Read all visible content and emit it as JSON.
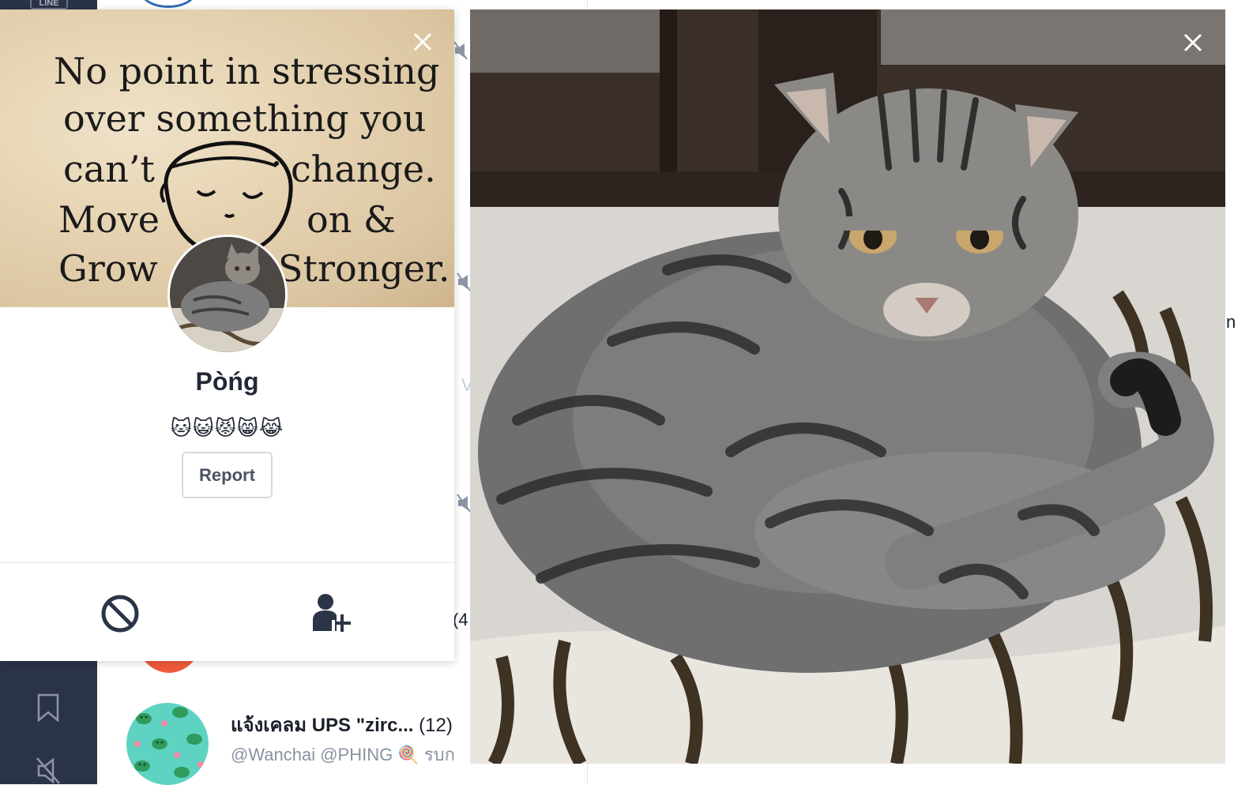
{
  "app": {
    "logo_text": "LINE",
    "accent_color": "#2b3447",
    "chat_rows": [
      {
        "title": "แจ้งเคลม UPS \"zirc...",
        "count": "(12)",
        "preview": "@Wanchai @PHING 🍭 รบก"
      }
    ],
    "peek_count": "(4",
    "peek_char_right": "n",
    "peek_char_mid": "V"
  },
  "profile": {
    "cover_quote": [
      "No point in stressing",
      "over something you",
      "can’t",
      "change.",
      "Move",
      "on &",
      "Grow",
      "Stronger."
    ],
    "name": "Pòńg",
    "status": "🐱😺😾😸😹",
    "report_label": "Report",
    "actions": [
      "block-icon",
      "add-friend-icon"
    ]
  },
  "viewer": {
    "icons": [
      "close-icon"
    ]
  }
}
